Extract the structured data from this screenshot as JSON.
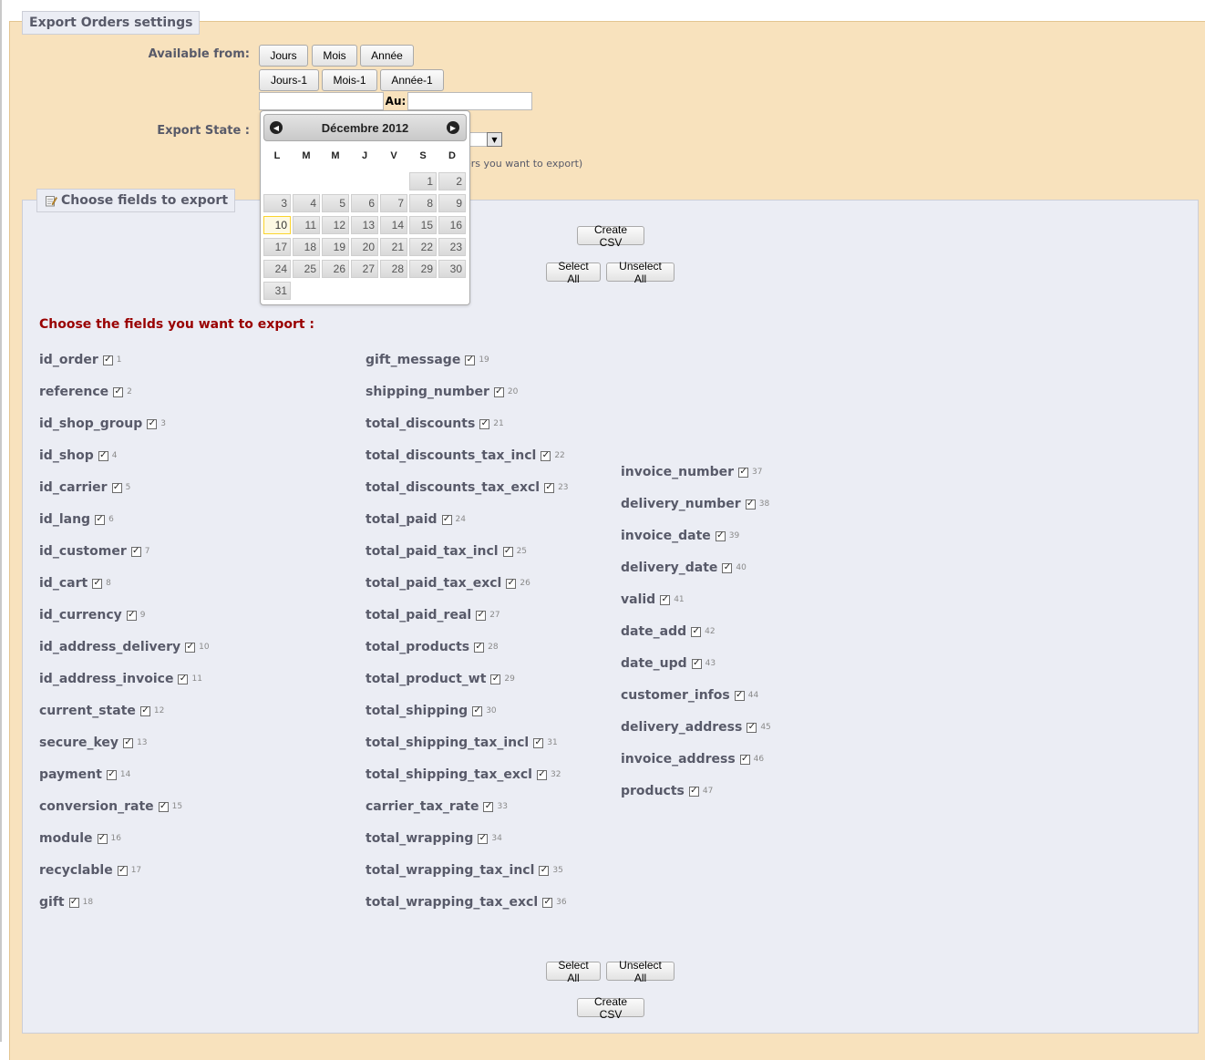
{
  "settings": {
    "legend": "Export Orders settings",
    "available_from_label": "Available from:",
    "period_buttons": [
      "Jours",
      "Mois",
      "Année"
    ],
    "prev_period_buttons": [
      "Jours-1",
      "Mois-1",
      "Année-1"
    ],
    "from_date_value": "",
    "to_label": "Au:",
    "to_date_value": "",
    "export_state_label": "Export State :",
    "state_hint_fragment": "ers you want to export)"
  },
  "calendar": {
    "title": "Décembre 2012",
    "prev_icon": "circle-arrow-left-icon",
    "next_icon": "circle-arrow-right-icon",
    "weekdays": [
      "L",
      "M",
      "M",
      "J",
      "V",
      "S",
      "D"
    ],
    "leading_blank_days": 5,
    "days": [
      "1",
      "2",
      "3",
      "4",
      "5",
      "6",
      "7",
      "8",
      "9",
      "10",
      "11",
      "12",
      "13",
      "14",
      "15",
      "16",
      "17",
      "18",
      "19",
      "20",
      "21",
      "22",
      "23",
      "24",
      "25",
      "26",
      "27",
      "28",
      "29",
      "30",
      "31"
    ],
    "highlighted_day": "10"
  },
  "fields_panel": {
    "legend": "Choose fields to export",
    "legend_icon": "notepad-edit-icon",
    "create_csv_label": "Create CSV",
    "select_all_label": "Select All",
    "unselect_all_label": "Unselect All",
    "title": "Choose the fields you want to export :",
    "columns": [
      [
        {
          "name": "id_order",
          "num": "1",
          "checked": true
        },
        {
          "name": "reference",
          "num": "2",
          "checked": true
        },
        {
          "name": "id_shop_group",
          "num": "3",
          "checked": true
        },
        {
          "name": "id_shop",
          "num": "4",
          "checked": true
        },
        {
          "name": "id_carrier",
          "num": "5",
          "checked": true
        },
        {
          "name": "id_lang",
          "num": "6",
          "checked": true
        },
        {
          "name": "id_customer",
          "num": "7",
          "checked": true
        },
        {
          "name": "id_cart",
          "num": "8",
          "checked": true
        },
        {
          "name": "id_currency",
          "num": "9",
          "checked": true
        },
        {
          "name": "id_address_delivery",
          "num": "10",
          "checked": true
        },
        {
          "name": "id_address_invoice",
          "num": "11",
          "checked": true
        },
        {
          "name": "current_state",
          "num": "12",
          "checked": true
        },
        {
          "name": "secure_key",
          "num": "13",
          "checked": true
        },
        {
          "name": "payment",
          "num": "14",
          "checked": true
        },
        {
          "name": "conversion_rate",
          "num": "15",
          "checked": true
        },
        {
          "name": "module",
          "num": "16",
          "checked": true
        },
        {
          "name": "recyclable",
          "num": "17",
          "checked": true
        },
        {
          "name": "gift",
          "num": "18",
          "checked": true
        }
      ],
      [
        {
          "name": "gift_message",
          "num": "19",
          "checked": true
        },
        {
          "name": "shipping_number",
          "num": "20",
          "checked": true
        },
        {
          "name": "total_discounts",
          "num": "21",
          "checked": true
        },
        {
          "name": "total_discounts_tax_incl",
          "num": "22",
          "checked": true
        },
        {
          "name": "total_discounts_tax_excl",
          "num": "23",
          "checked": true
        },
        {
          "name": "total_paid",
          "num": "24",
          "checked": true
        },
        {
          "name": "total_paid_tax_incl",
          "num": "25",
          "checked": true
        },
        {
          "name": "total_paid_tax_excl",
          "num": "26",
          "checked": true
        },
        {
          "name": "total_paid_real",
          "num": "27",
          "checked": true
        },
        {
          "name": "total_products",
          "num": "28",
          "checked": true
        },
        {
          "name": "total_product_wt",
          "num": "29",
          "checked": true
        },
        {
          "name": "total_shipping",
          "num": "30",
          "checked": true
        },
        {
          "name": "total_shipping_tax_incl",
          "num": "31",
          "checked": true
        },
        {
          "name": "total_shipping_tax_excl",
          "num": "32",
          "checked": true
        },
        {
          "name": "carrier_tax_rate",
          "num": "33",
          "checked": true
        },
        {
          "name": "total_wrapping",
          "num": "34",
          "checked": true
        },
        {
          "name": "total_wrapping_tax_incl",
          "num": "35",
          "checked": true
        },
        {
          "name": "total_wrapping_tax_excl",
          "num": "36",
          "checked": true
        }
      ],
      [
        {
          "name": "invoice_number",
          "num": "37",
          "checked": true
        },
        {
          "name": "delivery_number",
          "num": "38",
          "checked": true
        },
        {
          "name": "invoice_date",
          "num": "39",
          "checked": true
        },
        {
          "name": "delivery_date",
          "num": "40",
          "checked": true
        },
        {
          "name": "valid",
          "num": "41",
          "checked": true
        },
        {
          "name": "date_add",
          "num": "42",
          "checked": true
        },
        {
          "name": "date_upd",
          "num": "43",
          "checked": true
        },
        {
          "name": "customer_infos",
          "num": "44",
          "checked": true
        },
        {
          "name": "delivery_address",
          "num": "45",
          "checked": true
        },
        {
          "name": "invoice_address",
          "num": "46",
          "checked": true
        },
        {
          "name": "products",
          "num": "47",
          "checked": true
        }
      ]
    ]
  },
  "colors": {
    "settings_bg": "#f8e2bd",
    "panel_bg": "#ebedf4",
    "title_red": "#990000",
    "label_gray": "#585a69",
    "today_highlight": "#fdf9e3"
  }
}
